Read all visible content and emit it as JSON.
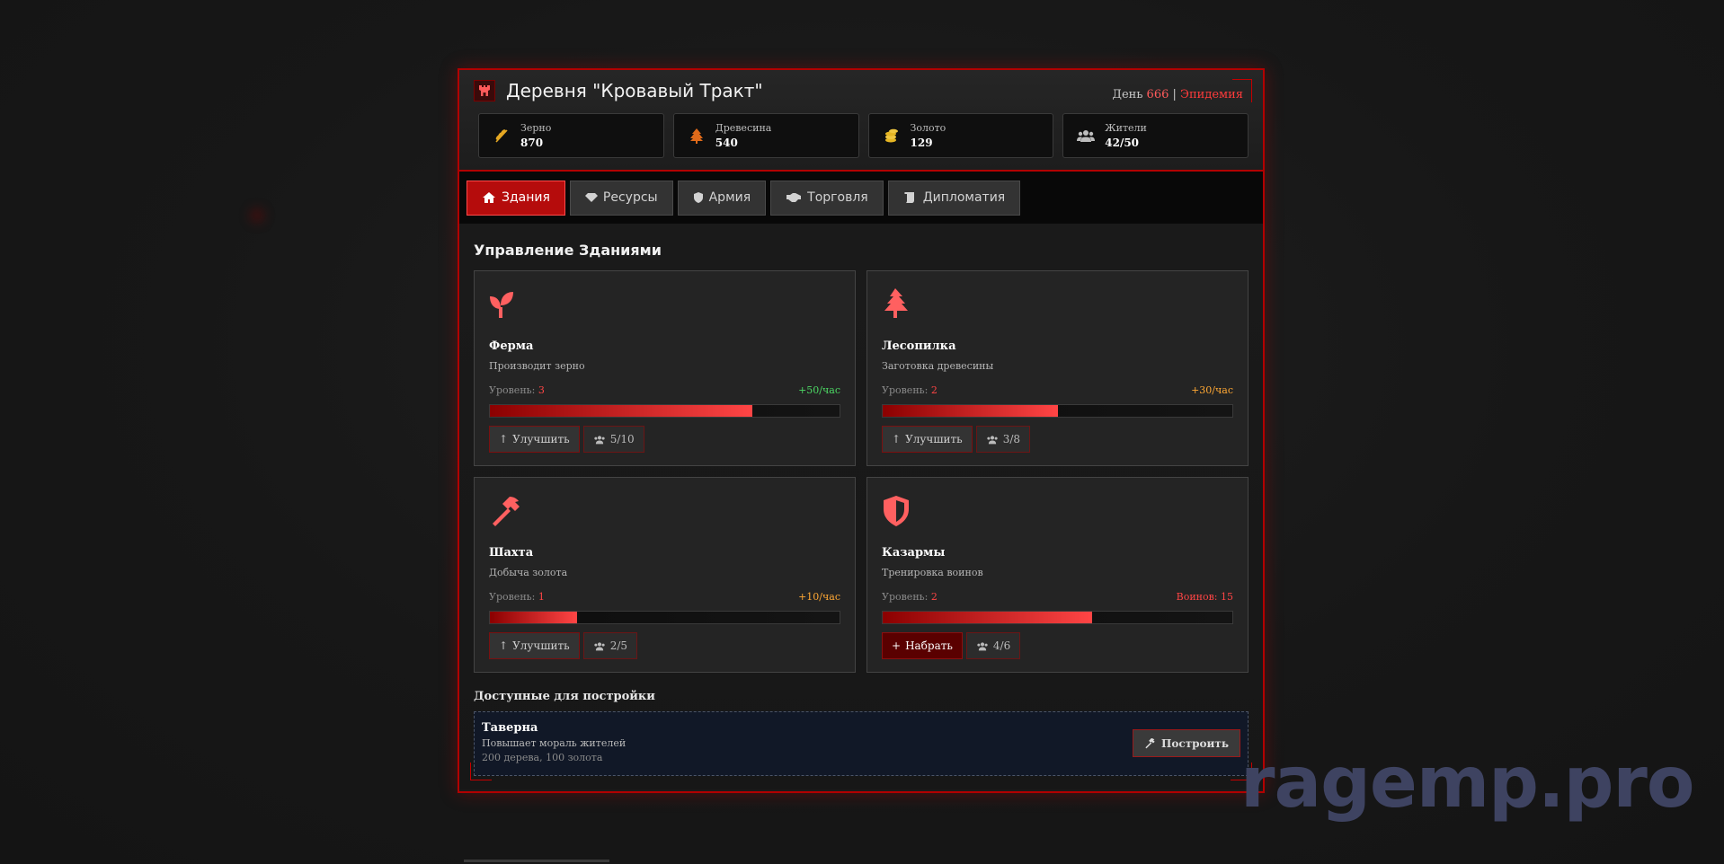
{
  "header": {
    "title": "Деревня \"Кровавый Тракт\"",
    "day_label": "День",
    "day_number": "666",
    "separator": "|",
    "status": "Эпидемия"
  },
  "stats": [
    {
      "label": "Зерно",
      "value": "870",
      "icon": "wheat-icon"
    },
    {
      "label": "Древесина",
      "value": "540",
      "icon": "tree-icon"
    },
    {
      "label": "Золото",
      "value": "129",
      "icon": "coins-icon"
    },
    {
      "label": "Жители",
      "value": "42/50",
      "icon": "users-icon"
    }
  ],
  "tabs": [
    {
      "label": "Здания",
      "icon": "home-icon",
      "active": true
    },
    {
      "label": "Ресурсы",
      "icon": "gem-icon"
    },
    {
      "label": "Армия",
      "icon": "shield-icon"
    },
    {
      "label": "Торговля",
      "icon": "handshake-icon"
    },
    {
      "label": "Дипломатия",
      "icon": "scroll-icon"
    }
  ],
  "section_title": "Управление Зданиями",
  "level_label": "Уровень:",
  "buildings": [
    {
      "name": "Ферма",
      "desc": "Производит зерно",
      "level": "3",
      "rate": "+50/час",
      "progress": 0.75,
      "action": "Улучшить",
      "workers": "5/10",
      "icon": "seedling-icon"
    },
    {
      "name": "Лесопилка",
      "desc": "Заготовка древесины",
      "level": "2",
      "rate": "+30/час",
      "progress": 0.5,
      "action": "Улучшить",
      "workers": "3/8",
      "icon": "tree-icon"
    },
    {
      "name": "Шахта",
      "desc": "Добыча золота",
      "level": "1",
      "rate": "+10/час",
      "progress": 0.25,
      "action": "Улучшить",
      "workers": "2/5",
      "icon": "hammer-icon"
    },
    {
      "name": "Казармы",
      "desc": "Тренировка воинов",
      "level": "2",
      "rate": "Воинов: 15",
      "progress": 0.6,
      "action": "Набрать",
      "workers": "4/6",
      "icon": "shield-icon"
    }
  ],
  "available": {
    "title": "Доступные для постройки",
    "name": "Таверна",
    "desc": "Повышает мораль жителей",
    "cost": "200 дерева, 100 золота",
    "button": "Построить"
  },
  "watermark": "ragemp.pro",
  "colors": {
    "accent": "#b20000",
    "bright_red": "#ff4545",
    "green": "#4cd964",
    "orange": "#ffa834"
  }
}
